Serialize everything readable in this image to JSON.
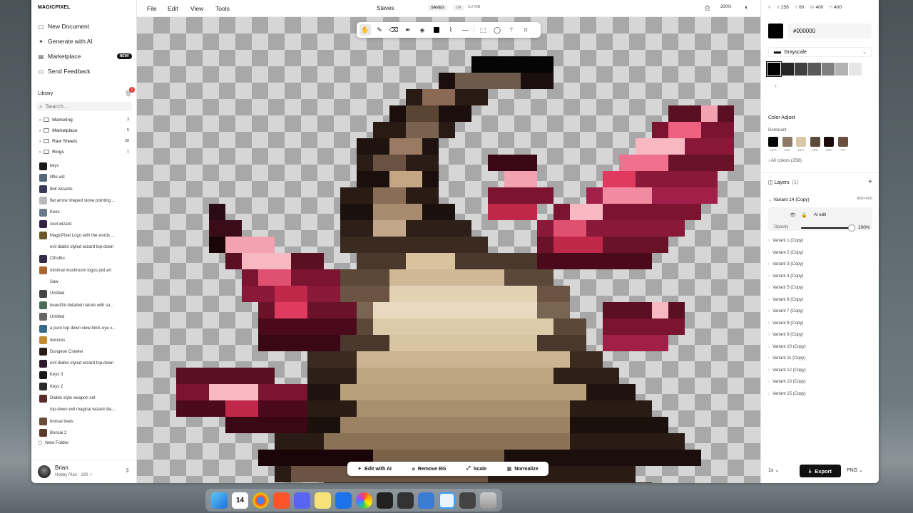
{
  "app": {
    "logo": "MAGICPIXEL"
  },
  "nav": [
    {
      "label": "New Document",
      "icon": "document-icon"
    },
    {
      "label": "Generate with AI",
      "icon": "sparkle-icon"
    },
    {
      "label": "Marketplace",
      "icon": "marketplace-icon",
      "badge": "NEW!"
    },
    {
      "label": "Send Feedback",
      "icon": "message-icon"
    }
  ],
  "library": {
    "title": "Library",
    "trash_badge": "1",
    "search_placeholder": "Search...",
    "folders": [
      {
        "name": "Marketing",
        "count": "3"
      },
      {
        "name": "Marketplace",
        "count": "5"
      },
      {
        "name": "Raw Sheets",
        "count": "39"
      },
      {
        "name": "Rings",
        "count": "1"
      }
    ],
    "items": [
      {
        "name": "keys",
        "color": "#1a1a1a"
      },
      {
        "name": "little wiz",
        "color": "#556677"
      },
      {
        "name": "8bit wizards",
        "color": "#3a3a5a"
      },
      {
        "name": "flat arrow shaped stone pointing ...",
        "color": "#b9b9b9"
      },
      {
        "name": "Kees",
        "color": "#6a7a8a"
      },
      {
        "name": "cool wizard",
        "color": "#332244"
      },
      {
        "name": "MagicPixel Logo with the words ...",
        "color": "#6a5a2a"
      },
      {
        "name": "evil diablo styled wizard top-down",
        "color": "#ffffff"
      },
      {
        "name": "Cthulhu",
        "color": "#3a2a4a"
      },
      {
        "name": "minimal mushroom logos pixl art",
        "color": "#aa6633"
      },
      {
        "name": "Saw",
        "color": "#ffffff"
      },
      {
        "name": "Untitled",
        "color": "#444444"
      },
      {
        "name": "beautiful detailed nature with so...",
        "color": "#4a6a5a"
      },
      {
        "name": "Untitled",
        "color": "#666666"
      },
      {
        "name": "a pure top down view birds eye v...",
        "color": "#3a6a8a"
      },
      {
        "name": "textures",
        "color": "#c08a30"
      },
      {
        "name": "Dungeon Crawler",
        "color": "#2a1a1a"
      },
      {
        "name": "evil diablo styled wizard top-down",
        "color": "#2a1a2a"
      },
      {
        "name": "Keys 3",
        "color": "#1a1a1a"
      },
      {
        "name": "Keys 2",
        "color": "#2a2a2a"
      },
      {
        "name": "Diablo style weapon set",
        "color": "#5a2a2a"
      },
      {
        "name": "top-down evil magical wizard dia...",
        "color": "#ffffff"
      },
      {
        "name": "bonsai trees",
        "color": "#6a4a3a"
      },
      {
        "name": "Bonsai 2",
        "color": "#5a3a2a"
      }
    ],
    "new_folder": "New Folder"
  },
  "user": {
    "name": "Brian",
    "plan": "Hobby Plan · 180 ⚡"
  },
  "menu": [
    "File",
    "Edit",
    "View",
    "Tools"
  ],
  "document": {
    "title": "Staves",
    "status": "SAVED",
    "ok": "OK",
    "size": "9.2 MB",
    "zoom": "200%"
  },
  "toolbar": [
    "hand-icon",
    "pencil-icon",
    "eraser-icon",
    "pen-icon",
    "fill-icon",
    "color-square-icon",
    "eyedropper-icon",
    "line-icon",
    "select-rect-icon",
    "lasso-icon",
    "magic-wand-icon",
    "crop-icon"
  ],
  "actions": [
    {
      "label": "Edit with AI",
      "icon": "sparkle-icon"
    },
    {
      "label": "Remove BG",
      "icon": "remove-bg-icon"
    },
    {
      "label": "Scale",
      "icon": "scale-icon"
    },
    {
      "label": "Normalize",
      "icon": "grid-icon"
    }
  ],
  "inspector": {
    "x": "256",
    "y": "60",
    "w": "400",
    "h": "400",
    "x_label": "X",
    "y_label": "Y",
    "w_label": "W",
    "h_label": "H",
    "color_hex": "#000000",
    "palette_name": "Grayscale",
    "grayscale": [
      "#000000",
      "#262626",
      "#404040",
      "#595959",
      "#808080",
      "#b3b3b3",
      "#e6e6e6"
    ],
    "color_adjust": "Color Adjust",
    "dominant_label": "Dominant",
    "dominant": [
      {
        "color": "#050505",
        "pct": "19%"
      },
      {
        "color": "#8c7a66",
        "pct": "15%"
      },
      {
        "color": "#d9c7a6",
        "pct": "14%"
      },
      {
        "color": "#5c4a3d",
        "pct": "13%"
      },
      {
        "color": "#1a0a0a",
        "pct": "13%"
      },
      {
        "color": "#6b5040",
        "pct": "7%"
      }
    ],
    "all_colors": "All colors (256)"
  },
  "layers": {
    "title": "Layers",
    "count": "(1)",
    "active": {
      "name": "Variant 14 (Copy)",
      "size": "400×400",
      "sublabel": "AI edit",
      "opacity_label": "Opacity",
      "opacity": "100%"
    },
    "variants": [
      "Variant 1 (Copy)",
      "Variant 2 (Copy)",
      "Variant 3 (Copy)",
      "Variant 4 (Copy)",
      "Variant 5 (Copy)",
      "Variant 6 (Copy)",
      "Variant 7 (Copy)",
      "Variant 8 (Copy)",
      "Variant 9 (Copy)",
      "Variant 10 (Copy)",
      "Variant 11 (Copy)",
      "Variant 12 (Copy)",
      "Variant 13 (Copy)",
      "Variant 15 (Copy)"
    ]
  },
  "export": {
    "scale": "1x",
    "label": "Export",
    "format": "PNG"
  },
  "dock": {
    "calendar_day": "14"
  }
}
